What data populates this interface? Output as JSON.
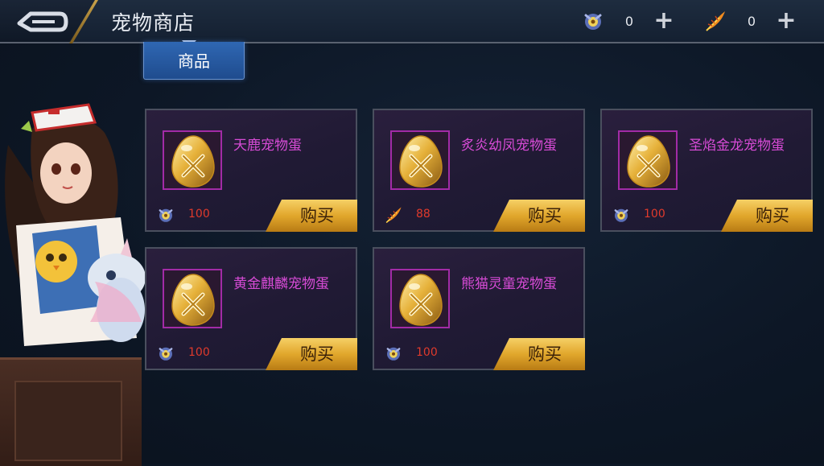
{
  "header": {
    "title": "宠物商店",
    "resources": [
      {
        "icon": "pet-coin-icon",
        "value": "0"
      },
      {
        "icon": "feather-icon",
        "value": "0"
      }
    ]
  },
  "tabs": [
    {
      "label": "商品",
      "active": true
    }
  ],
  "shop": {
    "items": [
      {
        "name": "天鹿宠物蛋",
        "currency_icon": "pet-coin-icon",
        "price": "100",
        "buy_label": "购买"
      },
      {
        "name": "炙炎幼凤宠物蛋",
        "currency_icon": "feather-icon",
        "price": "88",
        "buy_label": "购买"
      },
      {
        "name": "圣焰金龙宠物蛋",
        "currency_icon": "pet-coin-icon",
        "price": "100",
        "buy_label": "购买"
      },
      {
        "name": "黄金麒麟宠物蛋",
        "currency_icon": "pet-coin-icon",
        "price": "100",
        "buy_label": "购买"
      },
      {
        "name": "熊猫灵童宠物蛋",
        "currency_icon": "pet-coin-icon",
        "price": "100",
        "buy_label": "购买"
      }
    ]
  },
  "colors": {
    "item_name": "#d74bd6",
    "price": "#e03a2c",
    "buy_button": "#e1a72c",
    "tab_active": "#2f67b3"
  }
}
